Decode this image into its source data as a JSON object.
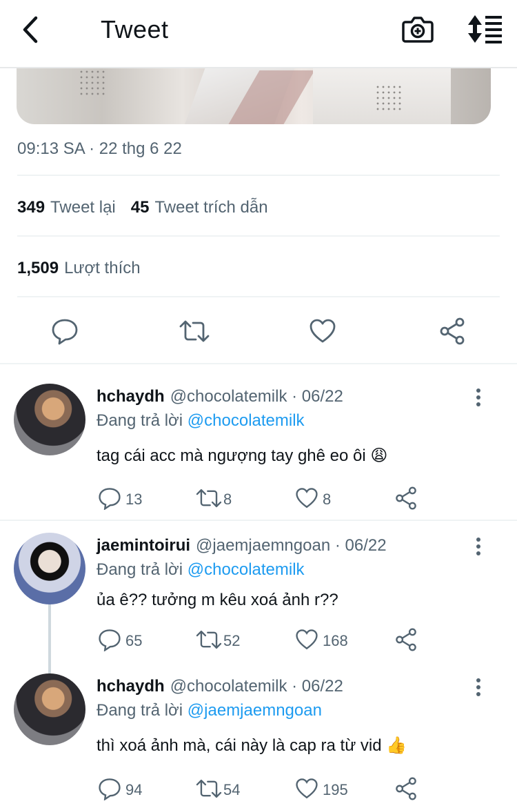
{
  "header": {
    "title": "Tweet",
    "icons": [
      "back-arrow-icon",
      "camera-plus-icon",
      "sort-icon"
    ]
  },
  "tweet": {
    "timestamp": "09:13 SA · 22 thg 6 22",
    "retweets_count": "349",
    "retweets_label": "Tweet lại",
    "quotes_count": "45",
    "quotes_label": "Tweet trích dẫn",
    "likes_count": "1,509",
    "likes_label": "Lượt thích",
    "actions": [
      "reply-icon",
      "retweet-icon",
      "like-icon",
      "share-icon"
    ]
  },
  "replies": [
    {
      "name": "hchaydh",
      "handle": "@chocolatemilk",
      "date": "· 06/22",
      "replying_prefix": "Đang trả lời",
      "replying_to": "@chocolatemilk",
      "text": "tag cái acc mà ngượng tay ghê eo ôi",
      "emoji": "😩",
      "reply_count": "13",
      "retweet_count": "8",
      "like_count": "8"
    },
    {
      "name": "jaemintoirui",
      "handle": "@jaemjaemngoan",
      "date": "· 06/22",
      "replying_prefix": "Đang trả lời",
      "replying_to": "@chocolatemilk",
      "text": "ủa ê?? tưởng m kêu xoá ảnh r??",
      "emoji": "",
      "reply_count": "65",
      "retweet_count": "52",
      "like_count": "168"
    },
    {
      "name": "hchaydh",
      "handle": "@chocolatemilk",
      "date": "· 06/22",
      "replying_prefix": "Đang trả lời",
      "replying_to": "@jaemjaemngoan",
      "text": "thì xoá ảnh mà, cái này là cap ra từ vid",
      "emoji": "👍",
      "reply_count": "94",
      "retweet_count": "54",
      "like_count": "195"
    }
  ],
  "colors": {
    "text_primary": "#0f1419",
    "text_secondary": "#536471",
    "mention": "#1d9bf0",
    "divider": "#eff3f4"
  }
}
